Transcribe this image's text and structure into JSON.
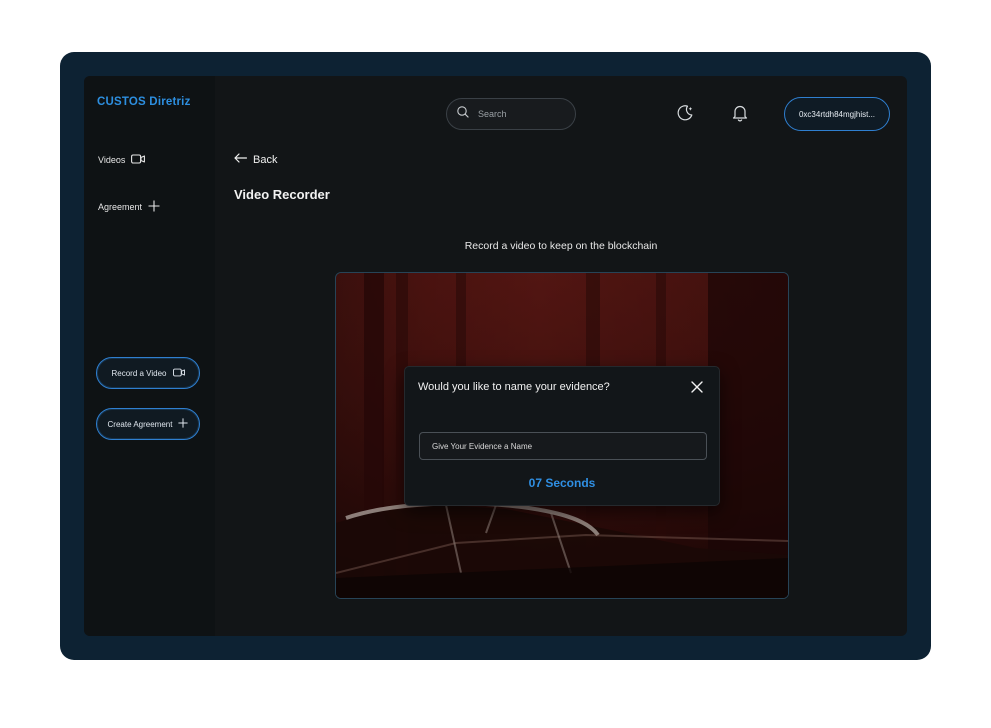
{
  "app": {
    "logo": "CUSTOS Diretriz",
    "accent_color": "#2d8fe0"
  },
  "sidebar": {
    "items": [
      {
        "label": "Videos",
        "icon": "video-camera-icon"
      },
      {
        "label": "Agreement",
        "icon": "plus-icon"
      }
    ],
    "actions": [
      {
        "label": "Record a Video",
        "icon": "video-camera-icon"
      },
      {
        "label": "Create Agreement",
        "icon": "plus-icon"
      }
    ]
  },
  "header": {
    "search": {
      "placeholder": "Search",
      "icon": "search-icon"
    },
    "theme_icon": "moon-icon",
    "notification_icon": "bell-icon",
    "wallet_address": "0xc34rtdh84mgjhist..."
  },
  "main": {
    "back_label": "Back",
    "title": "Video Recorder",
    "subtitle": "Record a video to keep on the blockchain"
  },
  "modal": {
    "title": "Would you like to name your evidence?",
    "input_placeholder": "Give Your Evidence a Name",
    "input_value": "",
    "countdown": "07 Seconds",
    "close_icon": "close-icon"
  }
}
